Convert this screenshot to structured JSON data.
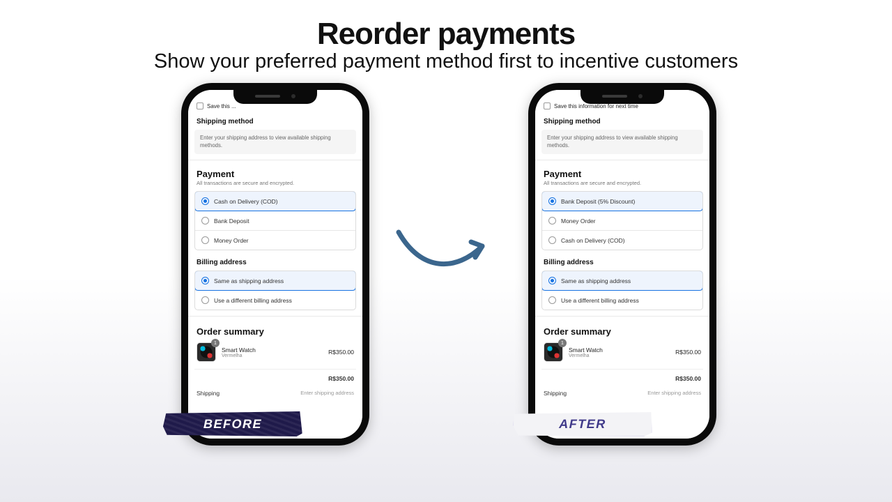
{
  "heading": {
    "title": "Reorder payments",
    "subtitle": "Show your preferred payment method first to incentive customers"
  },
  "labels": {
    "before": "BEFORE",
    "after": "AFTER"
  },
  "common": {
    "save_info": "Save this information for next time",
    "shipping_method_title": "Shipping method",
    "shipping_note": "Enter your shipping address to view available shipping methods.",
    "payment_title": "Payment",
    "payment_sub": "All transactions are secure and encrypted.",
    "billing_title": "Billing address",
    "billing_same": "Same as shipping address",
    "billing_diff": "Use a different billing address",
    "order_title": "Order summary",
    "product_name": "Smart Watch",
    "product_variant": "Vermelha",
    "product_qty": "1",
    "product_price": "R$350.00",
    "shipping_label": "Shipping",
    "shipping_hint": "Enter shipping address",
    "subtotal_price": "R$350.00"
  },
  "before": {
    "save_info_short": "Save this ...",
    "payments": [
      {
        "label": "Cash on Delivery (COD)",
        "selected": true
      },
      {
        "label": "Bank Deposit",
        "selected": false
      },
      {
        "label": "Money Order",
        "selected": false
      }
    ]
  },
  "after": {
    "payments": [
      {
        "label": "Bank Deposit (5% Discount)",
        "selected": true
      },
      {
        "label": "Money Order",
        "selected": false
      },
      {
        "label": "Cash on Delivery (COD)",
        "selected": false
      }
    ]
  }
}
